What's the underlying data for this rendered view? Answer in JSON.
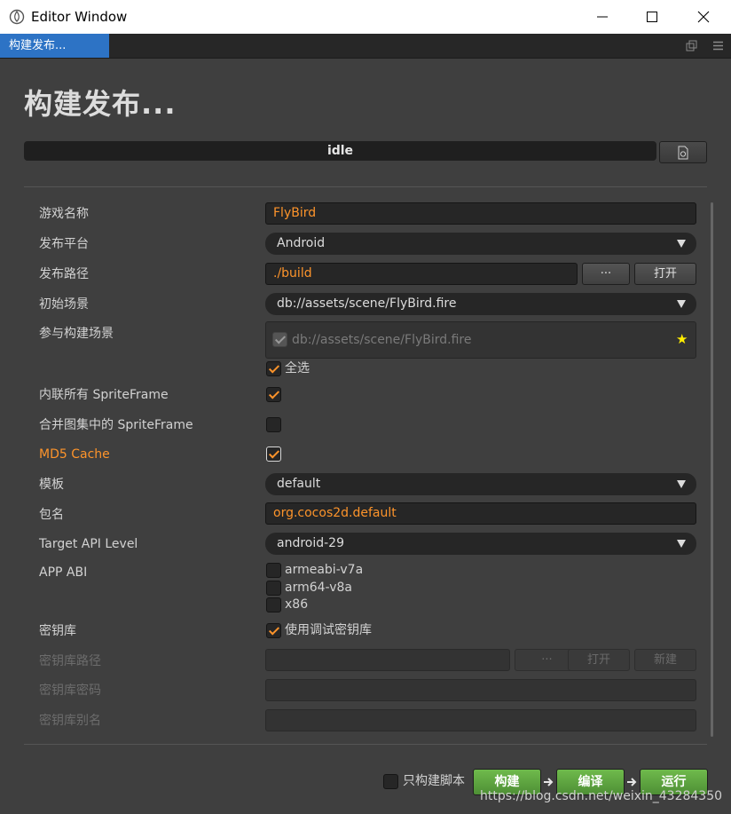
{
  "window": {
    "title": "Editor Window"
  },
  "tab": {
    "label": "构建发布..."
  },
  "panel": {
    "heading": "构建发布...",
    "status": "idle",
    "fields": {
      "game_name": {
        "label": "游戏名称",
        "value": "FlyBird"
      },
      "platform": {
        "label": "发布平台",
        "value": "Android"
      },
      "build_path": {
        "label": "发布路径",
        "value": "./build",
        "browse_label": "···",
        "open_label": "打开"
      },
      "start_scene": {
        "label": "初始场景",
        "value": "db://assets/scene/FlyBird.fire"
      },
      "included_scenes": {
        "label": "参与构建场景",
        "scenes": [
          "db://assets/scene/FlyBird.fire"
        ],
        "select_all_label": "全选"
      },
      "inline_spriteframe": {
        "label": "内联所有 SpriteFrame",
        "checked": true
      },
      "merge_spriteframe": {
        "label": "合并图集中的 SpriteFrame",
        "checked": false
      },
      "md5_cache": {
        "label": "MD5 Cache",
        "checked": true
      },
      "template": {
        "label": "模板",
        "value": "default"
      },
      "package_name": {
        "label": "包名",
        "value": "org.cocos2d.default"
      },
      "target_api": {
        "label": "Target API Level",
        "value": "android-29"
      },
      "app_abi": {
        "label": "APP ABI",
        "options": [
          {
            "label": "armeabi-v7a",
            "checked": false
          },
          {
            "label": "arm64-v8a",
            "checked": false
          },
          {
            "label": "x86",
            "checked": false
          }
        ]
      },
      "keystore": {
        "label": "密钥库",
        "debug_label": "使用调试密钥库",
        "checked": true
      },
      "keystore_path": {
        "label": "密钥库路径",
        "value": "",
        "browse_label": "···",
        "open_label": "打开",
        "new_label": "新建"
      },
      "keystore_password": {
        "label": "密钥库密码",
        "value": ""
      },
      "keystore_alias": {
        "label": "密钥库别名",
        "value": ""
      }
    },
    "footer": {
      "script_only_label": "只构建脚本",
      "build_label": "构建",
      "compile_label": "编译",
      "run_label": "运行"
    }
  },
  "watermark": "https://blog.csdn.net/weixin_43284350",
  "colors": {
    "accent": "#fd942b",
    "tab_active": "#2d73c5",
    "action_green": "#5aa23d",
    "star": "#ffee00"
  }
}
